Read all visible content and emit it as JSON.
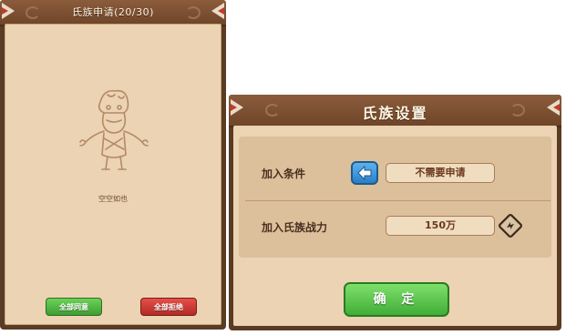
{
  "applications": {
    "title": "氏族申请(20/30)",
    "empty_text": "空空如也",
    "accept_all_label": "全部同意",
    "reject_all_label": "全部拒绝"
  },
  "settings": {
    "title": "氏族设置",
    "join_condition_label": "加入条件",
    "join_condition_value": "不需要申请",
    "join_power_label": "加入氏族战力",
    "join_power_value": "150万",
    "confirm_label": "确 定"
  },
  "colors": {
    "frame": "#5a3b24",
    "parchment": "#ecd3b3",
    "green_button": "#4cba3e",
    "red_button": "#c7352e",
    "blue_button": "#3d94d8"
  }
}
